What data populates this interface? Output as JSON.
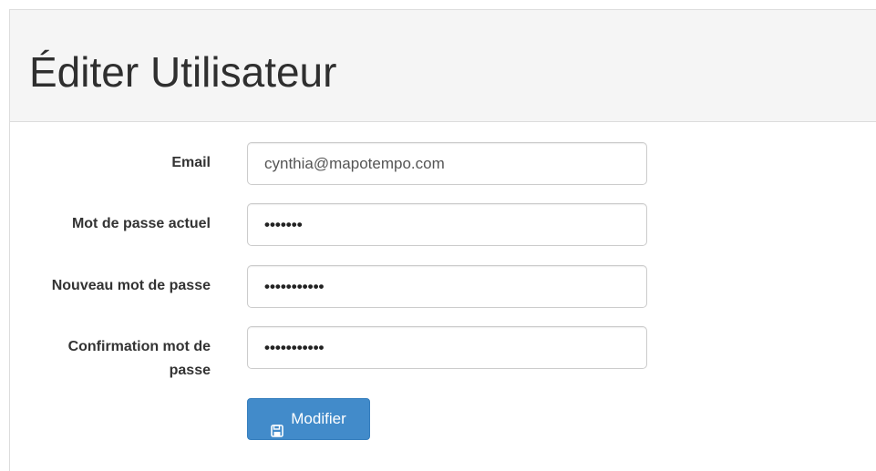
{
  "page": {
    "title": "Éditer Utilisateur"
  },
  "form": {
    "email": {
      "label": "Email",
      "value": "cynthia@mapotempo.com"
    },
    "current_password": {
      "label": "Mot de passe actuel",
      "value": "•••••••"
    },
    "new_password": {
      "label": "Nouveau mot de passe",
      "value": "•••••••••••"
    },
    "confirm_password": {
      "label_line1": "Confirmation mot de",
      "label_line2": "passe",
      "value": "•••••••••••"
    },
    "submit": {
      "label": "Modifier",
      "icon": "floppy-disk-icon"
    }
  },
  "colors": {
    "primary": "#428bca",
    "heading_bg": "#f5f5f5"
  }
}
